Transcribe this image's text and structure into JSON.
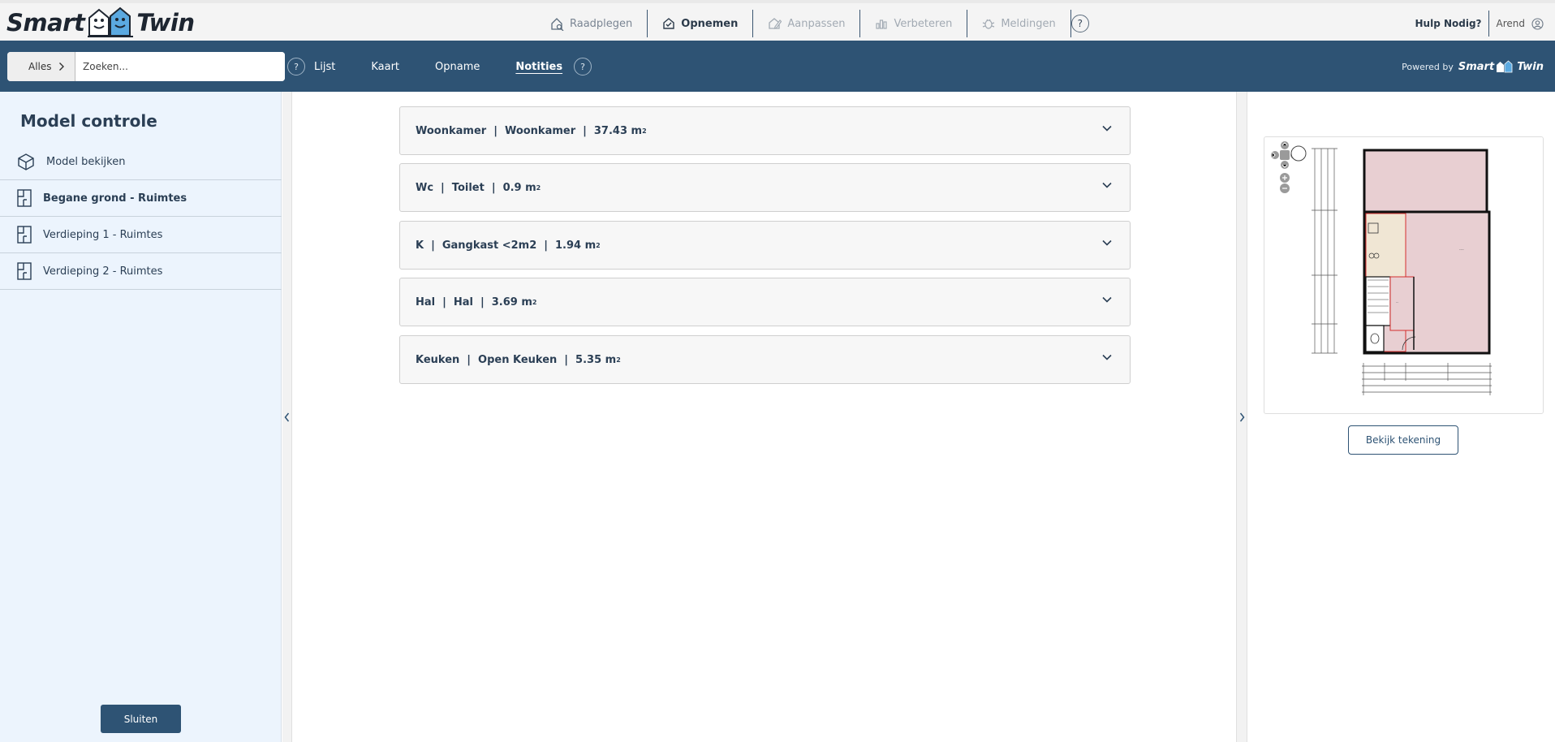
{
  "brand": {
    "word1": "Smart",
    "word2": "Twin"
  },
  "main_nav": [
    {
      "label": "Raadplegen",
      "state": "normal"
    },
    {
      "label": "Opnemen",
      "state": "active"
    },
    {
      "label": "Aanpassen",
      "state": "disabled"
    },
    {
      "label": "Verbeteren",
      "state": "disabled"
    },
    {
      "label": "Meldingen",
      "state": "disabled"
    }
  ],
  "help_symbol": "?",
  "top_right": {
    "help_label": "Hulp Nodig?",
    "user_name": "Arend"
  },
  "search": {
    "scope_label": "Alles",
    "placeholder": "Zoeken..."
  },
  "sub_tabs": [
    "Lijst",
    "Kaart",
    "Opname",
    "Notities"
  ],
  "active_sub_tab": "Notities",
  "powered_by": {
    "prefix": "Powered by",
    "word1": "Smart",
    "word2": "Twin"
  },
  "sidebar": {
    "title": "Model controle",
    "items": [
      {
        "label": "Model bekijken",
        "icon": "cube-icon",
        "active": false
      },
      {
        "label": "Begane grond - Ruimtes",
        "icon": "floorplan-icon",
        "active": true
      },
      {
        "label": "Verdieping 1 - Ruimtes",
        "icon": "floorplan-icon",
        "active": false
      },
      {
        "label": "Verdieping 2 - Ruimtes",
        "icon": "floorplan-icon",
        "active": false
      }
    ],
    "close_label": "Sluiten"
  },
  "rooms": [
    {
      "code": "Woonkamer",
      "name": "Woonkamer",
      "area": "37.43 m",
      "unit_sup": "2"
    },
    {
      "code": "Wc",
      "name": "Toilet",
      "area": "0.9 m",
      "unit_sup": "2"
    },
    {
      "code": "K",
      "name": "Gangkast <2m2",
      "area": "1.94 m",
      "unit_sup": "2"
    },
    {
      "code": "Hal",
      "name": "Hal",
      "area": "3.69 m",
      "unit_sup": "2"
    },
    {
      "code": "Keuken",
      "name": "Open Keuken",
      "area": "5.35 m",
      "unit_sup": "2"
    }
  ],
  "separator": "|",
  "drawing_button": "Bekijk tekening",
  "colors": {
    "primary": "#2e5374",
    "sidebar_bg": "#ecf4fd",
    "room_fill": "#e8cfd2",
    "room_border": "#d32f2f"
  }
}
